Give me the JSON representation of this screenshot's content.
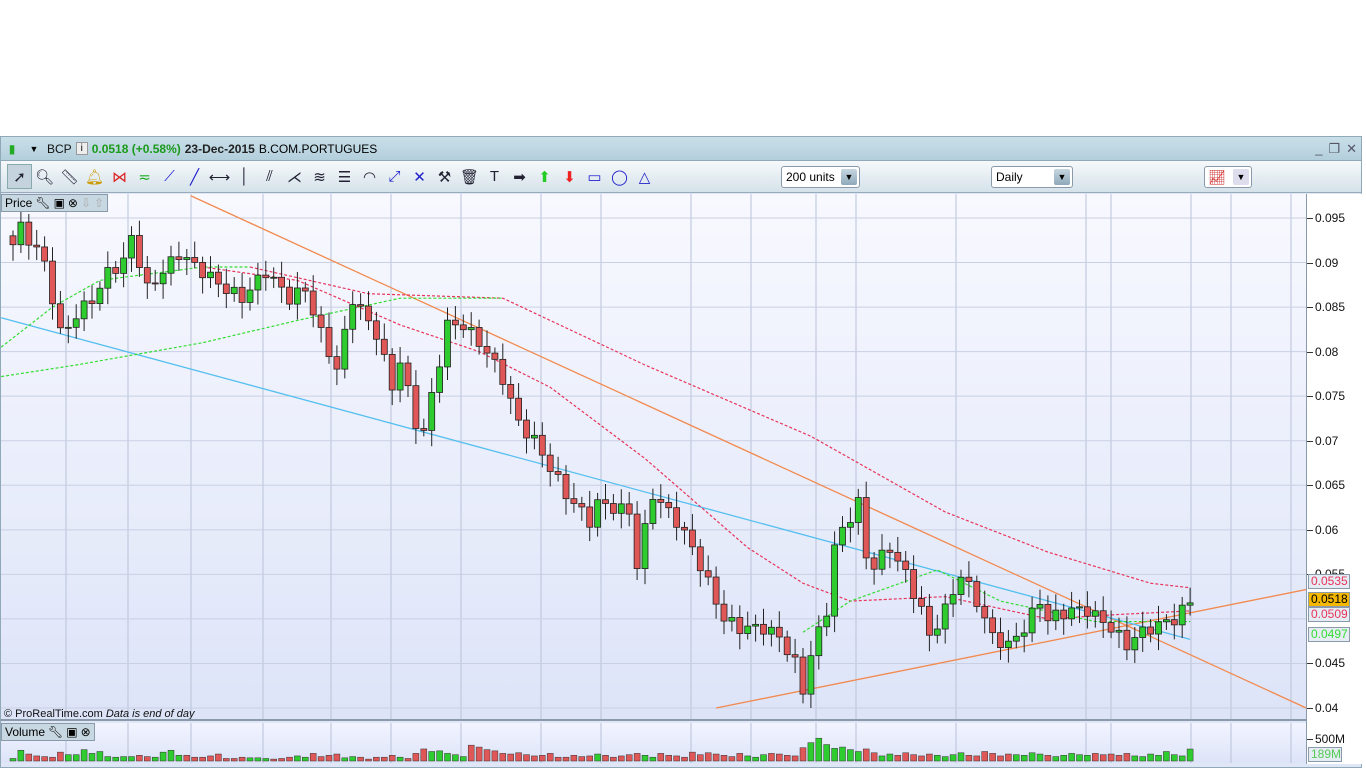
{
  "window": {
    "symbol": "BCP",
    "price": "0.0518 (+0.58%)",
    "date": "23-Dec-2015",
    "name": "B.COM.PORTUGUES",
    "controls": [
      "minimize",
      "restore",
      "close"
    ]
  },
  "toolbar": {
    "tools": [
      "pointer",
      "zoom",
      "ruler",
      "alert-bell",
      "triangle-pattern",
      "channel-pattern",
      "segment",
      "line",
      "horizontal-line",
      "vertical-line",
      "parallel",
      "fan-lines",
      "trend-channel",
      "fibonacci",
      "fibonacci-arcs",
      "point-segment",
      "crossed-lines",
      "tools",
      "trash",
      "text",
      "arrow-right",
      "arrow-up",
      "arrow-down",
      "rectangle",
      "ellipse",
      "triangle"
    ],
    "units": "200 units",
    "period": "Daily"
  },
  "price_panel": {
    "label": "Price",
    "footer": "© ProRealTime.com",
    "footer_note": "Data is end of day"
  },
  "volume_panel": {
    "label": "Volume",
    "axis_label": "500M",
    "last_volume": "189M"
  },
  "colors": {
    "up": "#2ecc2e",
    "down": "#e05757",
    "orange": "#f28a4f",
    "blue": "#55bff0",
    "ma_red": "#e8345a",
    "ma_green": "#33dd33"
  },
  "chart_data": {
    "type": "candlestick",
    "ylim": [
      0.0375,
      0.098
    ],
    "yticks": [
      "0.095",
      "0.09",
      "0.085",
      "0.08",
      "0.075",
      "0.07",
      "0.065",
      "0.06",
      "0.055",
      "0.045",
      "0.04"
    ],
    "price_labels": [
      {
        "text": "0.0535",
        "color": "#e8345a",
        "bg": "#e6ecf4",
        "value": 0.0535
      },
      {
        "text": "0.0509",
        "color": "#e8345a",
        "bg": "#e6ecf4",
        "value": 0.0509
      },
      {
        "text": "0.0518",
        "color": "#000",
        "bg": "#f5b800",
        "value": 0.0518
      },
      {
        "text": "0.0497",
        "color": "#33dd33",
        "bg": "#e6ecf4",
        "value": 0.0497
      }
    ],
    "bars": 150,
    "close_path": [
      [
        0,
        0.092
      ],
      [
        1,
        0.094
      ],
      [
        4,
        0.09
      ],
      [
        6,
        0.082
      ],
      [
        9,
        0.085
      ],
      [
        11,
        0.087
      ],
      [
        12,
        0.089
      ],
      [
        14,
        0.09
      ],
      [
        15,
        0.093
      ],
      [
        17,
        0.087
      ],
      [
        19,
        0.089
      ],
      [
        21,
        0.091
      ],
      [
        24,
        0.089
      ],
      [
        27,
        0.087
      ],
      [
        29,
        0.086
      ],
      [
        32,
        0.089
      ],
      [
        35,
        0.086
      ],
      [
        37,
        0.087
      ],
      [
        39,
        0.082
      ],
      [
        41,
        0.078
      ],
      [
        43,
        0.086
      ],
      [
        46,
        0.082
      ],
      [
        48,
        0.076
      ],
      [
        49,
        0.079
      ],
      [
        51,
        0.072
      ],
      [
        52,
        0.071
      ],
      [
        54,
        0.079
      ],
      [
        55,
        0.083
      ],
      [
        57,
        0.083
      ],
      [
        60,
        0.08
      ],
      [
        62,
        0.077
      ],
      [
        64,
        0.072
      ],
      [
        66,
        0.07
      ],
      [
        68,
        0.067
      ],
      [
        70,
        0.064
      ],
      [
        73,
        0.061
      ],
      [
        74,
        0.063
      ],
      [
        78,
        0.062
      ],
      [
        79,
        0.056
      ],
      [
        81,
        0.064
      ],
      [
        84,
        0.061
      ],
      [
        86,
        0.058
      ],
      [
        88,
        0.054
      ],
      [
        90,
        0.05
      ],
      [
        92,
        0.049
      ],
      [
        95,
        0.049
      ],
      [
        97,
        0.048
      ],
      [
        99,
        0.045
      ],
      [
        100,
        0.042
      ],
      [
        101,
        0.046
      ],
      [
        103,
        0.051
      ],
      [
        104,
        0.058
      ],
      [
        105,
        0.06
      ],
      [
        107,
        0.063
      ],
      [
        108,
        0.057
      ],
      [
        109,
        0.056
      ],
      [
        111,
        0.058
      ],
      [
        113,
        0.055
      ],
      [
        115,
        0.051
      ],
      [
        116,
        0.048
      ],
      [
        118,
        0.051
      ],
      [
        120,
        0.055
      ],
      [
        122,
        0.052
      ],
      [
        124,
        0.048
      ],
      [
        126,
        0.047
      ],
      [
        128,
        0.049
      ],
      [
        130,
        0.052
      ],
      [
        131,
        0.05
      ],
      [
        134,
        0.051
      ],
      [
        136,
        0.051
      ],
      [
        139,
        0.049
      ],
      [
        141,
        0.047
      ],
      [
        142,
        0.048
      ],
      [
        144,
        0.049
      ],
      [
        147,
        0.05
      ],
      [
        149,
        0.0518
      ]
    ],
    "moving_averages": [
      {
        "name": "MA long",
        "color": "#e8345a",
        "points": [
          [
            30,
            0.0895
          ],
          [
            45,
            0.0865
          ],
          [
            62,
            0.086
          ],
          [
            80,
            0.0785
          ],
          [
            101,
            0.0705
          ],
          [
            118,
            0.062
          ],
          [
            131,
            0.0575
          ],
          [
            144,
            0.054
          ],
          [
            149,
            0.0535
          ]
        ]
      },
      {
        "name": "MA mid",
        "color": "#e8345a",
        "points": [
          [
            24,
            0.0895
          ],
          [
            36,
            0.088
          ],
          [
            49,
            0.083
          ],
          [
            59,
            0.08
          ],
          [
            68,
            0.076
          ],
          [
            80,
            0.068
          ],
          [
            93,
            0.058
          ],
          [
            100,
            0.054
          ],
          [
            106,
            0.052
          ],
          [
            118,
            0.0525
          ],
          [
            131,
            0.05
          ],
          [
            140,
            0.0505
          ],
          [
            149,
            0.0509
          ]
        ]
      },
      {
        "name": "MA short",
        "color": "#33dd33",
        "points": [
          [
            -1.5,
            0.0805
          ],
          [
            5,
            0.085
          ],
          [
            11,
            0.088
          ],
          [
            24,
            0.0895
          ],
          [
            30,
            0.0895
          ]
        ]
      },
      {
        "name": "MA short 2",
        "color": "#33dd33",
        "points": [
          [
            -1.5,
            0.0772
          ],
          [
            8,
            0.0785
          ],
          [
            24,
            0.081
          ],
          [
            36,
            0.0835
          ],
          [
            49,
            0.086
          ],
          [
            62,
            0.086
          ]
        ]
      },
      {
        "name": "MA short 3",
        "color": "#33dd33",
        "points": [
          [
            100,
            0.0485
          ],
          [
            106,
            0.052
          ],
          [
            117,
            0.0555
          ],
          [
            125,
            0.052
          ],
          [
            137,
            0.0497
          ],
          [
            149,
            0.0497
          ]
        ]
      }
    ],
    "trendlines": [
      {
        "color": "#f28a4f",
        "from": [
          22.5,
          0.0975
        ],
        "to": [
          163.7,
          0.04
        ]
      },
      {
        "color": "#f28a4f",
        "from": [
          89,
          0.04
        ],
        "to": [
          163.7,
          0.0533
        ]
      },
      {
        "color": "#55bff0",
        "from": [
          -1.5,
          0.0838
        ],
        "to": [
          149,
          0.0477
        ]
      }
    ],
    "volume_max": 600,
    "volume_m": [
      40,
      170,
      110,
      80,
      70,
      60,
      140,
      100,
      100,
      180,
      120,
      150,
      70,
      60,
      70,
      70,
      90,
      70,
      60,
      140,
      170,
      90,
      90,
      60,
      60,
      80,
      110,
      40,
      40,
      60,
      50,
      50,
      40,
      30,
      40,
      60,
      80,
      60,
      120,
      70,
      90,
      110,
      50,
      70,
      60,
      30,
      60,
      60,
      90,
      60,
      40,
      120,
      190,
      150,
      160,
      120,
      100,
      70,
      250,
      220,
      180,
      160,
      120,
      110,
      130,
      100,
      80,
      90,
      120,
      60,
      60,
      90,
      70,
      80,
      110,
      90,
      60,
      80,
      100,
      120,
      90,
      60,
      120,
      90,
      80,
      60,
      140,
      100,
      130,
      110,
      90,
      70,
      120,
      80,
      60,
      100,
      120,
      110,
      90,
      80,
      210,
      290,
      360,
      260,
      200,
      220,
      180,
      150,
      190,
      130,
      80,
      110,
      90,
      130,
      100,
      80,
      110,
      90,
      70,
      100,
      130,
      90,
      80,
      150,
      120,
      80,
      110,
      100,
      90,
      130,
      110,
      90,
      70,
      90,
      120,
      100,
      90,
      120,
      100,
      110,
      90,
      120,
      80,
      70,
      110,
      90,
      150,
      100,
      80,
      189
    ]
  }
}
